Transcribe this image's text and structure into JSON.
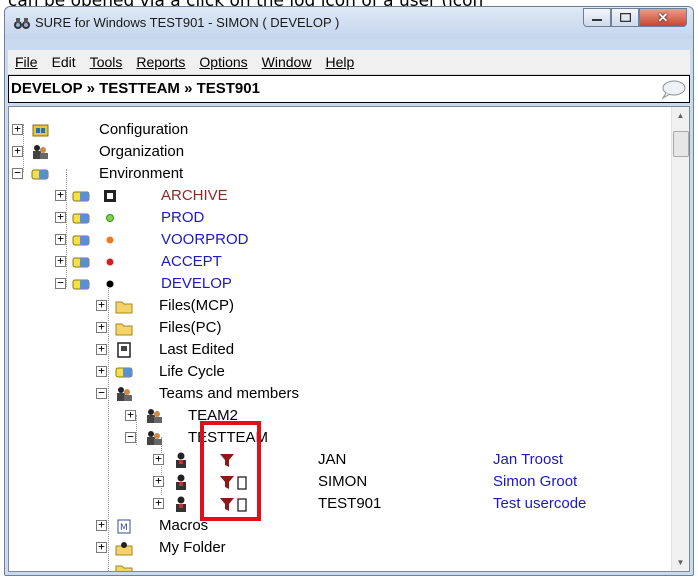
{
  "caption": "can be opened via a click on the log icon of a user (icon",
  "window": {
    "title": "SURE for Windows TEST901 - SIMON ( DEVELOP )"
  },
  "menu": [
    "File",
    "Edit",
    "Tools",
    "Reports",
    "Options",
    "Window",
    "Help"
  ],
  "breadcrumb": "DEVELOP » TESTTEAM » TEST901",
  "tree": {
    "configuration": "Configuration",
    "organization": "Organization",
    "environment": "Environment",
    "archive": "ARCHIVE",
    "prod": "PROD",
    "voorprod": "VOORPROD",
    "accept": "ACCEPT",
    "develop": "DEVELOP",
    "files_mcp": "Files(MCP)",
    "files_pc": "Files(PC)",
    "last_edited": "Last Edited",
    "life_cycle": "Life Cycle",
    "teams": "Teams and members",
    "team2": "TEAM2",
    "testteam": "TESTTEAM",
    "members": [
      {
        "code": "JAN",
        "name": "Jan Troost"
      },
      {
        "code": "SIMON",
        "name": "Simon Groot"
      },
      {
        "code": "TEST901",
        "name": "Test usercode"
      }
    ],
    "macros": "Macros",
    "my_folder": "My Folder"
  },
  "colors": {
    "archive": "#8a2b2b",
    "prod_dot": "#7ed64a",
    "voorprod_dot": "#f07a1a",
    "accept_dot": "#d42020",
    "develop_dot": "#000000",
    "blue_text": "#1d1ab5",
    "highlight": "#e0101a"
  }
}
